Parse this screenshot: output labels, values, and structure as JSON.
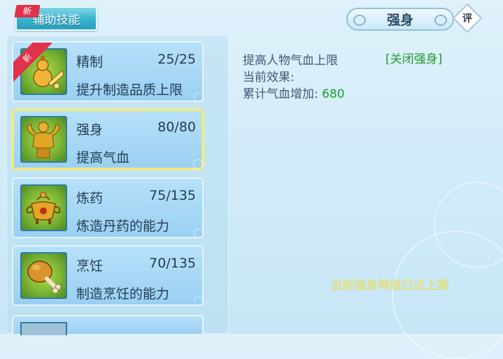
{
  "tab": {
    "label": "辅助技能",
    "badge": "新"
  },
  "header": {
    "title": "强身",
    "review_label": "评"
  },
  "skills": [
    {
      "name": "精制",
      "level": "25/25",
      "desc": "提升制造品质上限",
      "badge": "新",
      "icon": "gourd-icon"
    },
    {
      "name": "强身",
      "level": "80/80",
      "desc": "提高气血",
      "selected": true,
      "icon": "muscleman-icon"
    },
    {
      "name": "炼药",
      "level": "75/135",
      "desc": "炼造丹药的能力",
      "icon": "cauldron-icon"
    },
    {
      "name": "烹饪",
      "level": "70/135",
      "desc": "制造烹饪的能力",
      "icon": "drumstick-icon"
    }
  ],
  "detail": {
    "line1": "提高人物气血上限",
    "toggle": "[关闭强身]",
    "line2": "当前效果:",
    "line3_label": "累计气血增加:",
    "line3_value": "680",
    "max_note": "当前强身等级已达上限"
  },
  "colors": {
    "highlight_green": "#1f9c2a",
    "note_yellow": "#f0e25a",
    "selected_border": "#f5ea7a",
    "badge_red": "#e0324a"
  }
}
